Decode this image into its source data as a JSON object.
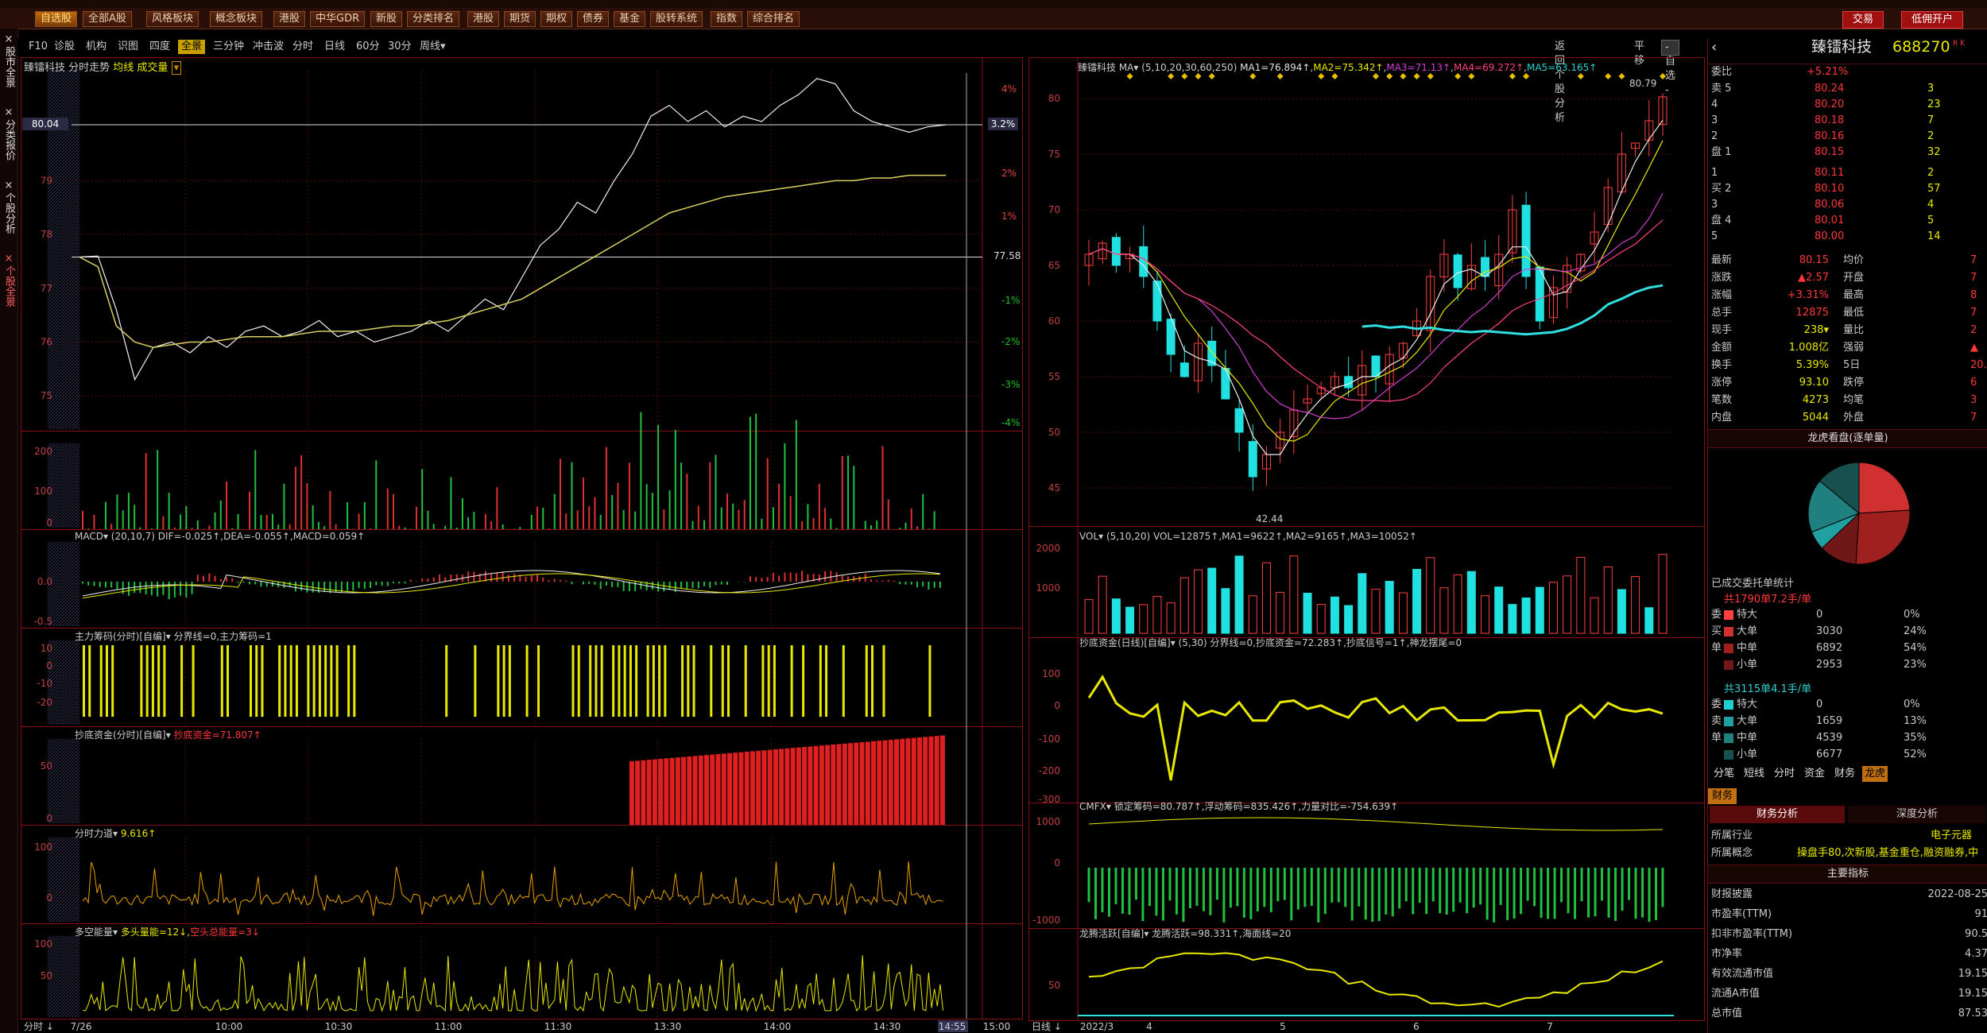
{
  "menubar": {
    "items": [
      "自选股",
      "全部A股",
      "风格板块",
      "概念板块",
      "港股",
      "中华GDR",
      "新股",
      "分类排名",
      "港股",
      "期货",
      "期权",
      "债券",
      "基金",
      "股转系统",
      "指数",
      "综合排名"
    ],
    "right_buttons": [
      "交易",
      "低佣开户"
    ]
  },
  "left_tabs": [
    "股市全景",
    "分类报价",
    "个股分析",
    "个股全景"
  ],
  "toolbar": {
    "items": [
      "F10",
      "诊股",
      "机构",
      "识图",
      "四度",
      "全景",
      "三分钟",
      "冲击波",
      "分时",
      "日线",
      "60分",
      "30分",
      "周线▾"
    ],
    "active": "全景",
    "right_items": [
      "返回个股分析",
      "平移",
      "- 自选 -"
    ]
  },
  "intraday": {
    "title": "臻镭科技  分时走势",
    "subtitle": "均线 成交量",
    "current_price": "80.04",
    "current_pct": "3.2%",
    "ref_price": "77.58",
    "price_ticks": [
      "79",
      "78",
      "77",
      "76",
      "75"
    ],
    "pct_ticks": [
      "4%",
      "2%",
      "1%",
      "-1%",
      "-2%",
      "-3%",
      "-4%"
    ],
    "vol_ticks": [
      "200",
      "100",
      "0"
    ],
    "time_ticks": [
      "7/26",
      "10:00",
      "10:30",
      "11:00",
      "11:30",
      "13:30",
      "14:00",
      "14:30",
      "14:55",
      "15:00"
    ],
    "time_label": "分时",
    "macd_title": "MACD▾  (20,10,7)  DIF=-0.025↑,DEA=-0.055↑,MACD=0.059↑",
    "macd_ticks": [
      "0.0",
      "-0.5"
    ],
    "zl_title": "主力筹码(分时)[自编]▾ 分界线=0,主力筹码=1",
    "zl_ticks": [
      "10",
      "0",
      "-10",
      "-20"
    ],
    "cd_title": "抄底资金(分时)[自编]▾",
    "cd_value": "抄底资金=71.807↑",
    "cd_ticks": [
      "50",
      "0"
    ],
    "fl_title": "分时力道▾",
    "fl_value": "9.616↑",
    "fl_ticks": [
      "100",
      "0"
    ],
    "dk_title": "多空能量▾",
    "dk_value": "多头量能=12↓,",
    "dk_value2": "空头总能量=3↓",
    "dk_ticks": [
      "100",
      "50"
    ]
  },
  "daily": {
    "title": "臻镭科技  MA▾  (5,10,20,30,60,250)",
    "ma1": "MA1=76.894↑",
    "ma2": "MA2=75.342↑",
    "ma3": "MA3=71.13↑",
    "ma4": "MA4=69.272↑",
    "ma5": "MA5=63.165↑",
    "high_label": "80.79",
    "low_label": "42.44",
    "price_ticks": [
      "80",
      "75",
      "70",
      "65",
      "60",
      "55",
      "50",
      "45"
    ],
    "vol_title": "VOL▾  (5,10,20)  VOL=12875↑,MA1=9622↑,MA2=9165↑,MA3=10052↑",
    "vol_ticks": [
      "2000",
      "1000"
    ],
    "cd_title": "抄底资金(日线)[自编]▾ (5,30)  分界线=0,抄底资金=72.283↑,抄底信号=1↑,神龙摆尾=0",
    "cd_ticks": [
      "100",
      "0",
      "-100",
      "-200",
      "-300"
    ],
    "cmfx_title": "CMFX▾  锁定筹码=80.787↑,浮动筹码=835.426↑,力量对比=-754.639↑",
    "cmfx_ticks": [
      "1000",
      "0",
      "-1000"
    ],
    "lt_title": "龙腾活跃[自编]▾ 龙腾活跃=98.331↑,海面线=20",
    "lt_ticks": [
      "50"
    ],
    "time_ticks": [
      "2022/3",
      "4",
      "5",
      "6",
      "7"
    ],
    "time_label": "日线"
  },
  "quote": {
    "name": "臻镭科技",
    "code": "688270",
    "badge": "R K",
    "webi": [
      "委比",
      "+5.21%"
    ],
    "sell": [
      {
        "label": "卖 5",
        "price": "80.24",
        "vol": "3"
      },
      {
        "label": "4",
        "price": "80.20",
        "vol": "23"
      },
      {
        "label": "3",
        "price": "80.18",
        "vol": "7"
      },
      {
        "label": "2",
        "price": "80.16",
        "vol": "2"
      },
      {
        "label": "盘 1",
        "price": "80.15",
        "vol": "32"
      }
    ],
    "buy": [
      {
        "label": "1",
        "price": "80.11",
        "vol": "2"
      },
      {
        "label": "买 2",
        "price": "80.10",
        "vol": "57"
      },
      {
        "label": "3",
        "price": "80.06",
        "vol": "4"
      },
      {
        "label": "盘 4",
        "price": "80.01",
        "vol": "5"
      },
      {
        "label": "5",
        "price": "80.00",
        "vol": "14"
      }
    ],
    "stats": [
      {
        "k1": "最新",
        "v1": "80.15",
        "k2": "均价",
        "v2": "7"
      },
      {
        "k1": "涨跌",
        "v1": "▲2.57",
        "k2": "开盘",
        "v2": "7"
      },
      {
        "k1": "涨幅",
        "v1": "+3.31%",
        "k2": "最高",
        "v2": "8"
      },
      {
        "k1": "总手",
        "v1": "12875",
        "k2": "最低",
        "v2": "7"
      },
      {
        "k1": "现手",
        "v1": "238▾",
        "k2": "量比",
        "v2": "2"
      },
      {
        "k1": "金额",
        "v1": "1.008亿",
        "k2": "强弱",
        "v2": "▲"
      },
      {
        "k1": "换手",
        "v1": "5.39%",
        "k2": "5日",
        "v2": "20."
      },
      {
        "k1": "涨停",
        "v1": "93.10",
        "k2": "跌停",
        "v2": "6"
      },
      {
        "k1": "笔数",
        "v1": "4273",
        "k2": "均笔",
        "v2": "3"
      },
      {
        "k1": "内盘",
        "v1": "5044",
        "k2": "外盘",
        "v2": "7"
      }
    ],
    "pie_title": "龙虎看盘(逐单量)",
    "order_title": "已成交委托单统计",
    "buy_summary": "共1790单7.2手/单",
    "buy_rows": [
      {
        "side": "委",
        "type": "特大",
        "n": "0",
        "pct": "0%",
        "color": "#ff4040"
      },
      {
        "side": "买",
        "type": "大单",
        "n": "3030",
        "pct": "24%",
        "color": "#d03030"
      },
      {
        "side": "单",
        "type": "中单",
        "n": "6892",
        "pct": "54%",
        "color": "#a02020"
      },
      {
        "side": "",
        "type": "小单",
        "n": "2953",
        "pct": "23%",
        "color": "#701818"
      }
    ],
    "sell_summary": "共3115单4.1手/单",
    "sell_rows": [
      {
        "side": "委",
        "type": "特大",
        "n": "0",
        "pct": "0%",
        "color": "#20d0d0"
      },
      {
        "side": "卖",
        "type": "大单",
        "n": "1659",
        "pct": "13%",
        "color": "#20a0a0"
      },
      {
        "side": "单",
        "type": "中单",
        "n": "4539",
        "pct": "35%",
        "color": "#208080"
      },
      {
        "side": "",
        "type": "小单",
        "n": "6677",
        "pct": "52%",
        "color": "#185050"
      }
    ],
    "tabs": [
      "分笔",
      "短线",
      "分时",
      "资金",
      "财务",
      "龙虎"
    ],
    "fin_tab": "财务",
    "fin_subtabs": [
      "财务分析",
      "深度分析"
    ],
    "industry_label": "所属行业",
    "industry": "电子元器",
    "concept_label": "所属概念",
    "concept": "操盘手80,次新股,基金重仓,融资融券,中",
    "indicator_title": "主要指标",
    "metrics": [
      {
        "k": "财报披露",
        "v": "2022-08-25"
      },
      {
        "k": "市盈率(TTM)",
        "v": "91"
      },
      {
        "k": "扣非市盈率(TTM)",
        "v": "90.5"
      },
      {
        "k": "市净率",
        "v": "4.37"
      },
      {
        "k": "有效流通市值",
        "v": "19.15"
      },
      {
        "k": "流通A市值",
        "v": "19.15"
      },
      {
        "k": "总市值",
        "v": "87.53"
      }
    ]
  },
  "chart_data": {
    "type": "line",
    "title": "臻镭科技",
    "intraday_price_samples": [
      77.58,
      77.6,
      76.6,
      75.3,
      75.9,
      76.0,
      75.8,
      76.1,
      75.9,
      76.2,
      76.3,
      76.1,
      76.2,
      76.4,
      76.1,
      76.2,
      76.0,
      76.1,
      76.2,
      76.4,
      76.2,
      76.5,
      76.8,
      76.6,
      77.2,
      77.8,
      78.1,
      78.6,
      78.4,
      79.0,
      79.5,
      80.2,
      80.4,
      80.1,
      80.3,
      80.0,
      80.2,
      80.1,
      80.4,
      80.6,
      80.9,
      80.8,
      80.3,
      80.1,
      80.0,
      79.9,
      80.0,
      80.04
    ],
    "intraday_avg_samples": [
      77.58,
      77.4,
      76.3,
      76.0,
      75.9,
      75.95,
      76.0,
      76.0,
      76.05,
      76.1,
      76.1,
      76.1,
      76.15,
      76.2,
      76.2,
      76.2,
      76.25,
      76.3,
      76.3,
      76.35,
      76.4,
      76.5,
      76.6,
      76.7,
      76.8,
      77.0,
      77.2,
      77.4,
      77.6,
      77.8,
      78.0,
      78.2,
      78.4,
      78.5,
      78.6,
      78.7,
      78.75,
      78.8,
      78.85,
      78.9,
      78.95,
      79.0,
      79.0,
      79.05,
      79.05,
      79.1,
      79.1,
      79.1
    ],
    "intraday_ylim": [
      74.5,
      81.0
    ],
    "daily_close_samples": [
      66,
      67,
      65,
      66,
      64,
      60,
      57,
      55,
      58,
      56,
      53,
      50,
      46,
      48,
      50,
      52,
      53,
      54,
      55,
      54,
      56,
      55,
      57,
      58,
      60,
      64,
      66,
      63,
      65,
      64,
      66,
      70,
      64,
      60,
      63,
      65,
      66,
      68,
      72,
      75,
      76,
      78,
      80.15
    ],
    "daily_ylim": [
      42,
      82
    ],
    "ma250_samples": [
      null,
      null,
      null,
      null,
      null,
      null,
      null,
      null,
      null,
      null,
      null,
      null,
      null,
      null,
      null,
      null,
      null,
      null,
      null,
      null,
      59.5,
      59.6,
      59.4,
      59.5,
      59.3,
      59.4,
      59.2,
      59.1,
      59.0,
      59.1,
      59.0,
      58.9,
      58.8,
      58.9,
      59.0,
      59.3,
      59.8,
      60.5,
      61.5,
      62.0,
      62.6,
      63.0,
      63.2
    ]
  }
}
